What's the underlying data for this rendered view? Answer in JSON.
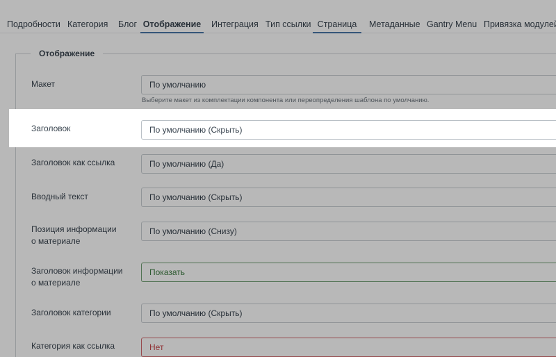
{
  "tabs": [
    {
      "label": "Подробности"
    },
    {
      "label": "Категория"
    },
    {
      "label": "Блог"
    },
    {
      "label": "Отображение"
    },
    {
      "label": "Интеграция"
    },
    {
      "label": "Тип ссылки"
    },
    {
      "label": "Страница"
    },
    {
      "label": "Метаданные"
    },
    {
      "label": "Gantry Menu"
    },
    {
      "label": "Привязка модулей"
    }
  ],
  "fieldset": {
    "legend": "Отображение",
    "rows": [
      {
        "label": "Макет",
        "value": "По умолчанию",
        "hint": "Выберите макет из комплектации компонента или переопределения шаблона по умолчанию."
      },
      {
        "label": "Заголовок",
        "value": "По умолчанию (Скрыть)"
      },
      {
        "label": "Заголовок как ссылка",
        "value": "По умолчанию (Да)"
      },
      {
        "label": "Вводный текст",
        "value": "По умолчанию (Скрыть)"
      },
      {
        "label_line1": "Позиция информации",
        "label_line2": "о материале",
        "value": "По умолчанию (Снизу)"
      },
      {
        "label_line1": "Заголовок информации",
        "label_line2": "о материале",
        "value": "Показать"
      },
      {
        "label": "Заголовок категории",
        "value": "По умолчанию (Скрыть)"
      },
      {
        "label": "Категория как ссылка",
        "value": "Нет"
      }
    ]
  },
  "colors": {
    "active_tab_underline": "#4a76a8",
    "green_field": "#3f7d43",
    "red_field": "#c8474c"
  }
}
